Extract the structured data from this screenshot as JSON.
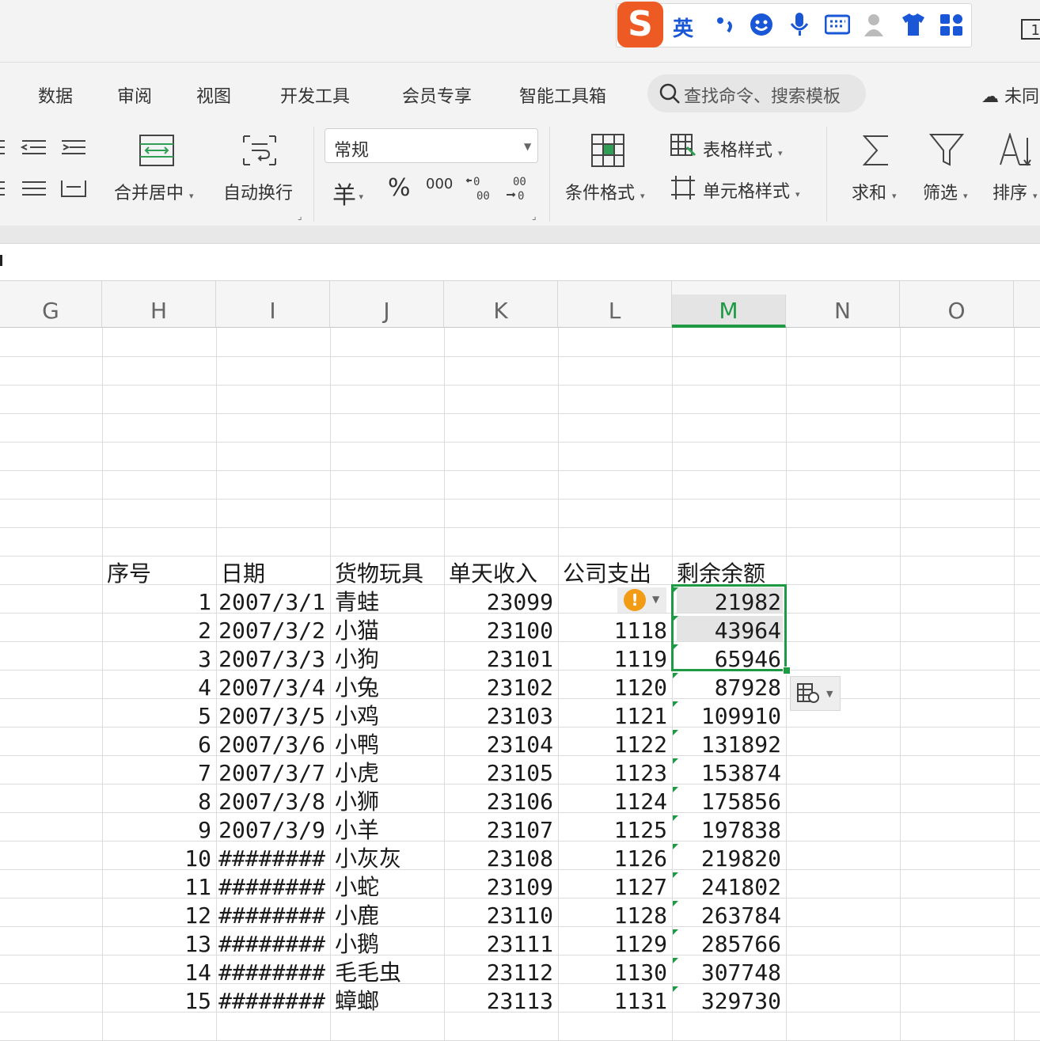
{
  "ime": {
    "logo": "S",
    "lang": "英",
    "icons": [
      "punctuation-icon",
      "emoji-icon",
      "microphone-icon",
      "keyboard-icon",
      "user-icon",
      "skin-icon",
      "toolbox-icon"
    ]
  },
  "window": {
    "partial_label": "1"
  },
  "menu": {
    "items": [
      "数据",
      "审阅",
      "视图",
      "开发工具",
      "会员专享",
      "智能工具箱"
    ],
    "search_placeholder": "查找命令、搜索模板",
    "cloud_label": "未同"
  },
  "ribbon": {
    "merge_label": "合并居中",
    "wrap_label": "自动换行",
    "number_format": "常规",
    "currency": "羊",
    "percent": "%",
    "thousands": "000",
    "cond_format": "条件格式",
    "table_style": "表格样式",
    "cell_style": "单元格样式",
    "sum": "求和",
    "filter": "筛选",
    "sort": "排序"
  },
  "columns": [
    "G",
    "H",
    "I",
    "J",
    "K",
    "L",
    "M",
    "N",
    "O"
  ],
  "active_column": "M",
  "table": {
    "headers": [
      "序号",
      "日期",
      "货物玩具",
      "单天收入",
      "公司支出",
      "剩余余额"
    ],
    "rows": [
      [
        "1",
        "2007/3/1",
        "青蛙",
        "23099",
        "",
        "21982"
      ],
      [
        "2",
        "2007/3/2",
        "小猫",
        "23100",
        "1118",
        "43964"
      ],
      [
        "3",
        "2007/3/3",
        "小狗",
        "23101",
        "1119",
        "65946"
      ],
      [
        "4",
        "2007/3/4",
        "小兔",
        "23102",
        "1120",
        "87928"
      ],
      [
        "5",
        "2007/3/5",
        "小鸡",
        "23103",
        "1121",
        "109910"
      ],
      [
        "6",
        "2007/3/6",
        "小鸭",
        "23104",
        "1122",
        "131892"
      ],
      [
        "7",
        "2007/3/7",
        "小虎",
        "23105",
        "1123",
        "153874"
      ],
      [
        "8",
        "2007/3/8",
        "小狮",
        "23106",
        "1124",
        "175856"
      ],
      [
        "9",
        "2007/3/9",
        "小羊",
        "23107",
        "1125",
        "197838"
      ],
      [
        "10",
        "########",
        "小灰灰",
        "23108",
        "1126",
        "219820"
      ],
      [
        "11",
        "########",
        "小蛇",
        "23109",
        "1127",
        "241802"
      ],
      [
        "12",
        "########",
        "小鹿",
        "23110",
        "1128",
        "263784"
      ],
      [
        "13",
        "########",
        "小鹅",
        "23111",
        "1129",
        "285766"
      ],
      [
        "14",
        "########",
        "毛毛虫",
        "23112",
        "1130",
        "307748"
      ],
      [
        "15",
        "########",
        "蟑螂",
        "23113",
        "1131",
        "329730"
      ]
    ]
  },
  "warning_glyph": "!",
  "colors": {
    "accent": "#1f9a44",
    "warning": "#f29b14",
    "ime_brand": "#ee5a24"
  }
}
